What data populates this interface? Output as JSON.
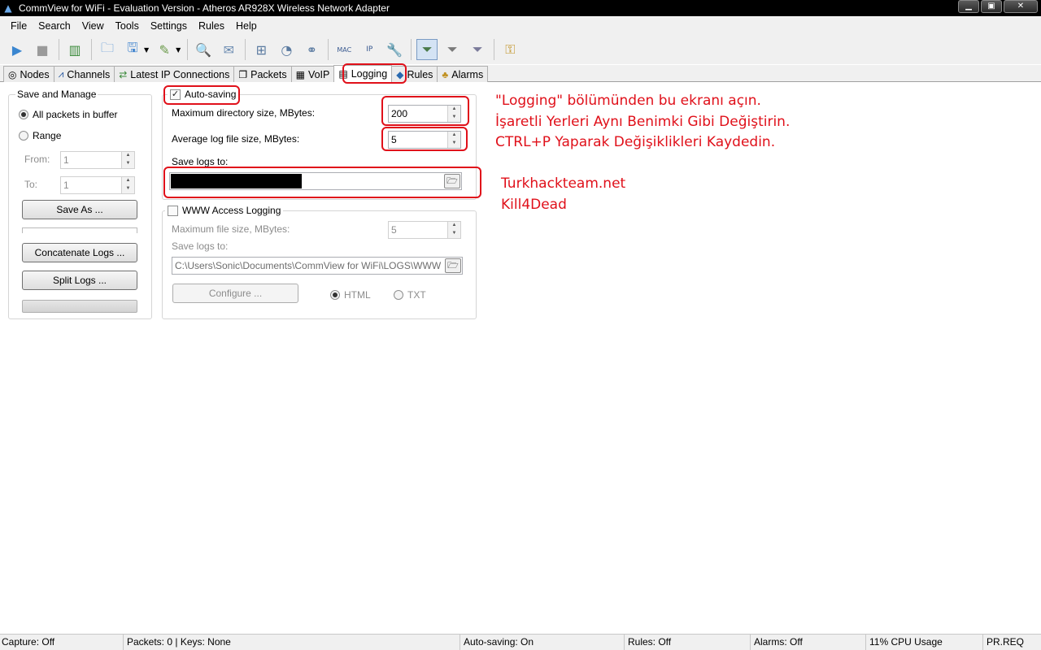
{
  "window": {
    "title": "CommView for WiFi - Evaluation Version - Atheros AR928X Wireless Network Adapter"
  },
  "menu": [
    "File",
    "Search",
    "View",
    "Tools",
    "Settings",
    "Rules",
    "Help"
  ],
  "tabs": [
    {
      "label": "Nodes",
      "icon": "nodes-icon"
    },
    {
      "label": "Channels",
      "icon": "channels-icon"
    },
    {
      "label": "Latest IP Connections",
      "icon": "ip-connections-icon"
    },
    {
      "label": "Packets",
      "icon": "packets-icon"
    },
    {
      "label": "VoIP",
      "icon": "voip-icon"
    },
    {
      "label": "Logging",
      "icon": "logging-icon",
      "active": true
    },
    {
      "label": "Rules",
      "icon": "rules-icon"
    },
    {
      "label": "Alarms",
      "icon": "alarms-icon"
    }
  ],
  "save_manage": {
    "title": "Save and Manage",
    "all_packets_label": "All packets in buffer",
    "range_label": "Range",
    "from_label": "From:",
    "from_value": "1",
    "to_label": "To:",
    "to_value": "1",
    "save_as_label": "Save As ...",
    "concatenate_label": "Concatenate Logs ...",
    "split_label": "Split Logs ..."
  },
  "autosaving": {
    "label": "Auto-saving",
    "checked": true,
    "max_dir_label": "Maximum directory size, MBytes:",
    "max_dir_value": "200",
    "avg_file_label": "Average log file size, MBytes:",
    "avg_file_value": "5",
    "save_logs_label": "Save logs to:"
  },
  "www_logging": {
    "label": "WWW Access Logging",
    "checked": false,
    "max_file_label": "Maximum file size, MBytes:",
    "max_file_value": "5",
    "save_logs_label": "Save logs to:",
    "path": "C:\\Users\\Sonic\\Documents\\CommView for WiFi\\LOGS\\WWW",
    "configure_label": "Configure ...",
    "html_label": "HTML",
    "txt_label": "TXT"
  },
  "notes": {
    "line1": "\"Logging\" bölümünden bu ekranı açın.",
    "line2": "İşaretli Yerleri Aynı Benimki Gibi Değiştirin.",
    "line3": "CTRL+P Yaparak Değişiklikleri Kaydedin.",
    "line4": "Turkhackteam.net",
    "line5": "Kill4Dead"
  },
  "status": {
    "capture": "Capture: Off",
    "packets": "Packets: 0 | Keys: None",
    "autosaving": "Auto-saving: On",
    "rules": "Rules: Off",
    "alarms": "Alarms: Off",
    "cpu": "11% CPU Usage",
    "preq": "PR.REQ"
  },
  "colors": {
    "annotation": "#e0101a"
  }
}
